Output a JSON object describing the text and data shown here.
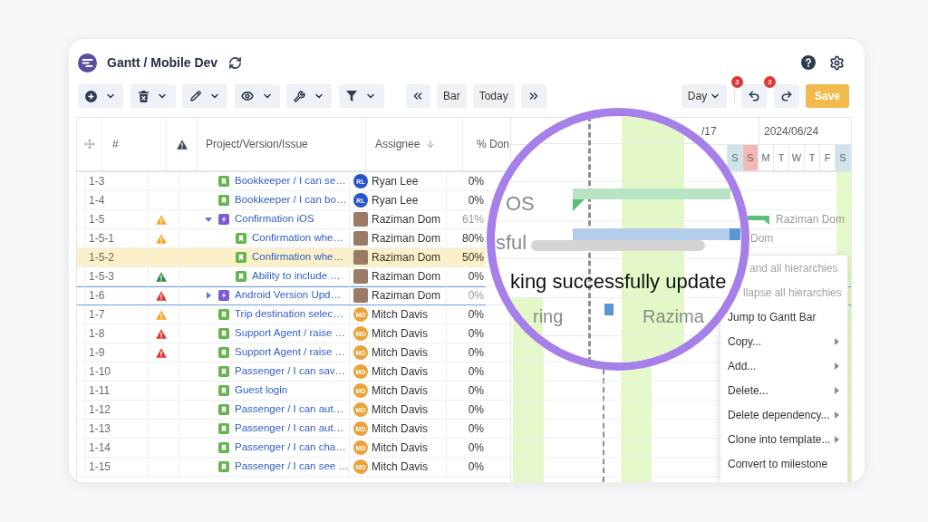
{
  "header": {
    "title": "Gantt / Mobile Dev"
  },
  "toolbar": {
    "nav_buttons": [
      "Bar",
      "Today"
    ],
    "scale": {
      "value": "Day"
    },
    "undo": {
      "badge": "2"
    },
    "redo": {
      "badge": "2"
    },
    "save": "Save"
  },
  "table": {
    "columns": [
      {
        "label": "#",
        "sorted": false
      },
      {
        "label": "Project/Version/Issue",
        "sorted": false
      },
      {
        "label": "Assignee",
        "sorted": true
      },
      {
        "label": "% Don",
        "sorted": false
      }
    ],
    "rows": [
      {
        "key": "1-3",
        "kind": "story",
        "title": "Bookkeeper / I can se…",
        "assignee": {
          "kind": "initials",
          "initials": "RL",
          "color": "#2855c9",
          "name": "Ryan Lee"
        },
        "done": "0%",
        "selected": false,
        "outlined": false
      },
      {
        "key": "1-4",
        "kind": "story",
        "title": "Bookkeeper / I can bo…",
        "assignee": {
          "kind": "initials",
          "initials": "RL",
          "color": "#2855c9",
          "name": "Ryan Lee"
        },
        "done": "0%",
        "selected": false,
        "outlined": false
      },
      {
        "key": "1-5",
        "alert": {
          "color": "#f5a623"
        },
        "kind": "epic",
        "expanded": true,
        "title": "Confirmation iOS",
        "assignee": {
          "kind": "photo",
          "name": "Raziman Dom"
        },
        "done": "61%",
        "selected": false,
        "outlined": false,
        "gantt_label": "Raziman Dom",
        "children": [
          {
            "key": "1-5-1",
            "alert": {
              "color": "#f5a623"
            },
            "kind": "story",
            "title": "Confirmation whe…",
            "assignee": {
              "kind": "photo",
              "name": "Raziman Dom"
            },
            "done": "80%",
            "selected": false,
            "outlined": false,
            "gantt_label": "Dom"
          },
          {
            "key": "1-5-2",
            "kind": "story",
            "title": "Confirmation whe…",
            "assignee": {
              "kind": "photo",
              "name": "Raziman Dom"
            },
            "done": "50%",
            "selected": true,
            "outlined": false
          },
          {
            "key": "1-5-3",
            "alert": {
              "color": "#2e8b3d"
            },
            "kind": "story",
            "title": "Ability to include …",
            "assignee": {
              "kind": "photo",
              "name": "Raziman Dom"
            },
            "done": "0%",
            "selected": false,
            "outlined": false
          }
        ]
      },
      {
        "key": "1-6",
        "alert": {
          "color": "#e0352b"
        },
        "kind": "epic",
        "expanded": false,
        "title": "Android Version Upd…",
        "assignee": {
          "kind": "photo",
          "name": "Raziman Dom"
        },
        "done": "0%",
        "selected": false,
        "outlined": true
      },
      {
        "key": "1-7",
        "alert": {
          "color": "#f5a623"
        },
        "kind": "story",
        "title": "Trip destination selec…",
        "assignee": {
          "kind": "initials",
          "initials": "MD",
          "color": "#e9a33c",
          "name": "Mitch Davis"
        },
        "done": "0%",
        "selected": false,
        "outlined": false
      },
      {
        "key": "1-8",
        "alert": {
          "color": "#e0352b"
        },
        "kind": "story",
        "title": "Support Agent / raise …",
        "assignee": {
          "kind": "initials",
          "initials": "MD",
          "color": "#e9a33c",
          "name": "Mitch Davis"
        },
        "done": "0%",
        "selected": false,
        "outlined": false
      },
      {
        "key": "1-9",
        "alert": {
          "color": "#e0352b"
        },
        "kind": "story",
        "title": "Support Agent / raise …",
        "assignee": {
          "kind": "initials",
          "initials": "MD",
          "color": "#e9a33c",
          "name": "Mitch Davis"
        },
        "done": "0%",
        "selected": false,
        "outlined": false
      },
      {
        "key": "1-10",
        "kind": "story",
        "title": "Passenger / I can sav…",
        "assignee": {
          "kind": "initials",
          "initials": "MD",
          "color": "#e9a33c",
          "name": "Mitch Davis"
        },
        "done": "0%",
        "selected": false,
        "outlined": false
      },
      {
        "key": "1-11",
        "kind": "story",
        "title": "Guest login",
        "assignee": {
          "kind": "initials",
          "initials": "MD",
          "color": "#e9a33c",
          "name": "Mitch Davis"
        },
        "done": "0%",
        "selected": false,
        "outlined": false
      },
      {
        "key": "1-12",
        "kind": "story",
        "title": "Passenger / I can aut…",
        "assignee": {
          "kind": "initials",
          "initials": "MD",
          "color": "#e9a33c",
          "name": "Mitch Davis"
        },
        "done": "0%",
        "selected": false,
        "outlined": false
      },
      {
        "key": "1-13",
        "kind": "story",
        "title": "Passenger / I can aut…",
        "assignee": {
          "kind": "initials",
          "initials": "MD",
          "color": "#e9a33c",
          "name": "Mitch Davis"
        },
        "done": "0%",
        "selected": false,
        "outlined": false
      },
      {
        "key": "1-14",
        "kind": "story",
        "title": "Passenger / I can cha…",
        "assignee": {
          "kind": "initials",
          "initials": "MD",
          "color": "#e9a33c",
          "name": "Mitch Davis"
        },
        "done": "0%",
        "selected": false,
        "outlined": false
      },
      {
        "key": "1-15",
        "kind": "story",
        "title": "Passenger / I can see …",
        "assignee": {
          "kind": "initials",
          "initials": "MD",
          "color": "#e9a33c",
          "name": "Mitch Davis"
        },
        "done": "0%",
        "selected": false,
        "outlined": false
      }
    ]
  },
  "gantt": {
    "weeks": [
      "/17",
      "2024/06/24"
    ],
    "days": [
      {
        "letter": "S",
        "kind": "saturday"
      },
      {
        "letter": "S",
        "kind": "sunday"
      },
      {
        "letter": "M",
        "kind": "weekday"
      },
      {
        "letter": "T",
        "kind": "weekday"
      },
      {
        "letter": "W",
        "kind": "weekday"
      },
      {
        "letter": "T",
        "kind": "weekday"
      },
      {
        "letter": "F",
        "kind": "weekday"
      },
      {
        "letter": "S",
        "kind": "saturday"
      }
    ]
  },
  "magnifier": {
    "labels": [
      "OS",
      "sful",
      "ring",
      "Razima"
    ],
    "tooltip": "king successfully update"
  },
  "context_menu": {
    "items": [
      {
        "label": "and all hierarchies",
        "disabled": true,
        "submenu": false
      },
      {
        "label": "llapse all hierarchies",
        "disabled": true,
        "submenu": false
      },
      {
        "label": "Jump to Gantt Bar",
        "disabled": false,
        "submenu": false
      },
      {
        "label": "Copy...",
        "disabled": false,
        "submenu": true
      },
      {
        "label": "Add...",
        "disabled": false,
        "submenu": true
      },
      {
        "label": "Delete...",
        "disabled": false,
        "submenu": true
      },
      {
        "label": "Delete dependency...",
        "disabled": false,
        "submenu": true
      },
      {
        "label": "Clone into template...",
        "disabled": false,
        "submenu": true
      },
      {
        "label": "Convert to milestone",
        "disabled": false,
        "submenu": false
      }
    ]
  }
}
